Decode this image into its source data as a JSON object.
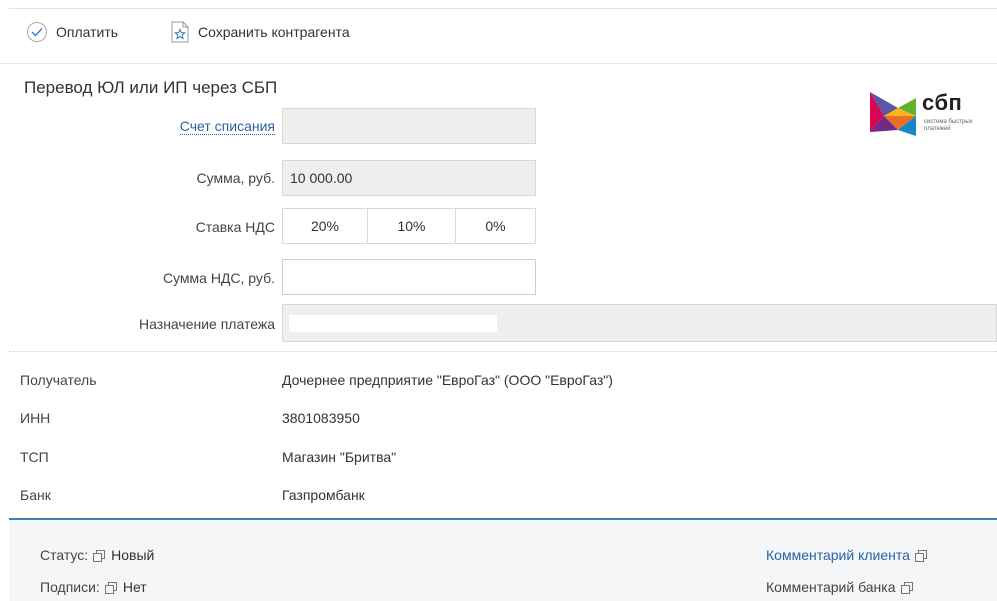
{
  "toolbar": {
    "pay_label": "Оплатить",
    "save_label": "Сохранить контрагента"
  },
  "form": {
    "title": "Перевод ЮЛ или ИП через СБП",
    "account_label": "Счет списания",
    "account_value": "",
    "amount_label": "Сумма, руб.",
    "amount_value": "10 000.00",
    "vat_rate_label": "Ставка НДС",
    "vat_options": [
      "20%",
      "10%",
      "0%"
    ],
    "vat_selected": "20%",
    "vat_sum_label": "Сумма НДС, руб.",
    "vat_sum_value": "",
    "purpose_label": "Назначение платежа",
    "purpose_value": ""
  },
  "logo": {
    "name": "сбп",
    "tagline_line1": "система быстрых",
    "tagline_line2": "платежей"
  },
  "recipient": {
    "rows": [
      {
        "label": "Получатель",
        "value": "Дочернее предприятие \"ЕвроГаз\" (ООО \"ЕвроГаз\")"
      },
      {
        "label": "ИНН",
        "value": "3801083950"
      },
      {
        "label": "ТСП",
        "value": "Магазин \"Бритва\""
      },
      {
        "label": "Банк",
        "value": "Газпромбанк"
      }
    ]
  },
  "status": {
    "status_label": "Статус:",
    "status_value": "Новый",
    "signatures_label": "Подписи:",
    "signatures_value": "Нет",
    "client_comment": "Комментарий клиента",
    "bank_comment": "Комментарий банка"
  },
  "colors": {
    "link": "#2a62a8",
    "accent_line": "#3c7fc1",
    "field_bg": "#efefef"
  }
}
